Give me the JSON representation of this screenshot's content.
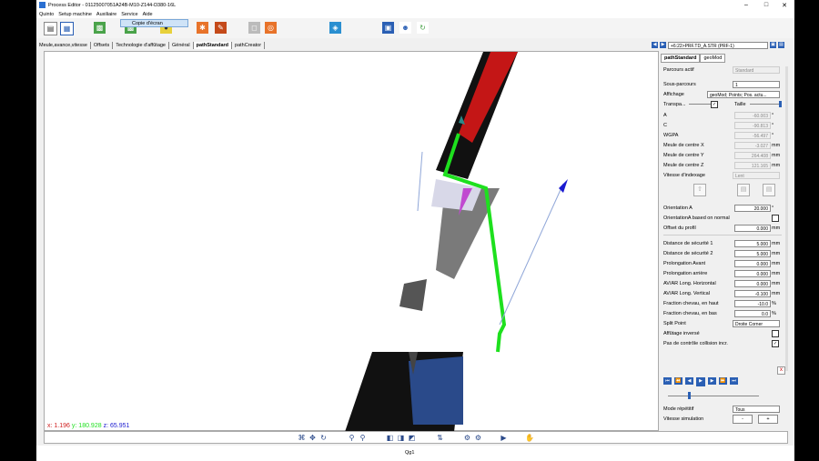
{
  "window": {
    "title": "Process Editor - 01125007051A24B-M10-Z144-D380-16L",
    "controls": [
      "–",
      "□",
      "✕"
    ]
  },
  "menu": [
    "Quinto",
    "Setup machine",
    "Auxiliaire",
    "Service",
    "Aide"
  ],
  "dropdown_item": "Copie d'écran",
  "tabs": [
    {
      "label": "Meule,avance,vitesse"
    },
    {
      "label": "Offsets"
    },
    {
      "label": "Technologie d'affûtage"
    },
    {
      "label": "Général"
    },
    {
      "label": "pathStandard"
    },
    {
      "label": "pathCreator"
    }
  ],
  "path_select": "+6:22>PRF.TD_A.STR (PRF-1)",
  "coords": {
    "x_label": "x:",
    "x": "1.196",
    "y_label": "y:",
    "y": "180.928",
    "z_label": "z:",
    "z": "65.951"
  },
  "status": "Qg1",
  "panel": {
    "tabs": [
      "pathStandard",
      "geoMod"
    ],
    "parcours_actif": {
      "label": "Parcours actif",
      "value": "Standard"
    },
    "sous_parcours": {
      "label": "Sous-parcours",
      "value": "1"
    },
    "affichage": {
      "label": "Affichage",
      "value": "geoMod; Points; Pos. actu..."
    },
    "transpa": {
      "label": "Transpa...",
      "taille": "Taille"
    },
    "fields": [
      {
        "label": "A",
        "value": "-60.003",
        "unit": "°"
      },
      {
        "label": "C",
        "value": "-90.813",
        "unit": "°"
      },
      {
        "label": "WGPA",
        "value": "-56.497",
        "unit": "°"
      },
      {
        "label": "Meule de centre X",
        "value": "-3.027",
        "unit": "mm"
      },
      {
        "label": "Meule de centre Y",
        "value": "264.408",
        "unit": "mm"
      },
      {
        "label": "Meule de centre Z",
        "value": "121.165",
        "unit": "mm"
      }
    ],
    "vitesse_indexage": {
      "label": "Vitesse d'indexage",
      "value": "Lent"
    },
    "orientation_a": {
      "label": "Orientation A",
      "value": "20.000",
      "unit": "°"
    },
    "orientation_normal": {
      "label": "OrientationA based on normal"
    },
    "offset_profil": {
      "label": "Offset du profil",
      "value": "0.000",
      "unit": "mm"
    },
    "params": [
      {
        "label": "Distance de sécurité 1",
        "value": "5.000",
        "unit": "mm"
      },
      {
        "label": "Distance de sécurité 2",
        "value": "5.000",
        "unit": "mm"
      },
      {
        "label": "Prolongation Avant",
        "value": "0.000",
        "unit": "mm"
      },
      {
        "label": "Prolongation arrière",
        "value": "0.000",
        "unit": "mm"
      },
      {
        "label": "AV/AR  Long. Horizontal",
        "value": "0.000",
        "unit": "mm"
      },
      {
        "label": "AV/AR  Long. Vertical",
        "value": "-0.100",
        "unit": "mm"
      },
      {
        "label": "Fraction chevau, en haut",
        "value": "-10.0",
        "unit": "%"
      },
      {
        "label": "Fraction chevau, en bas",
        "value": "0.0",
        "unit": "%"
      }
    ],
    "split_point": {
      "label": "Split Point",
      "value": "Droite Corner"
    },
    "affutage_inverse": {
      "label": "Affûtage inversé"
    },
    "pas_controle": {
      "label": "Pas de contrôle collision incr."
    },
    "close": "x",
    "mode_repetitif": {
      "label": "Mode répétitif",
      "value": "Tous"
    },
    "vitesse_simulation": {
      "label": "Vitesse simulation",
      "minus": "-",
      "plus": "+"
    }
  }
}
